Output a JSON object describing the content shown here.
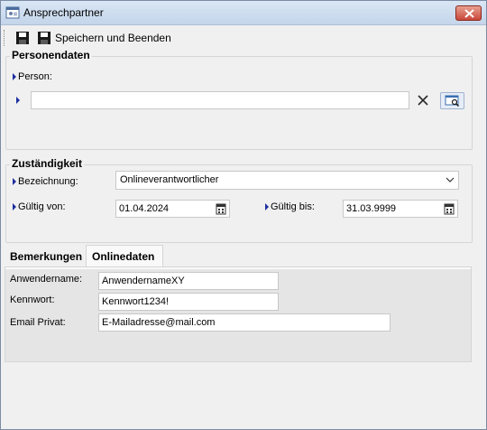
{
  "window": {
    "title": "Ansprechpartner"
  },
  "toolbar": {
    "save_close_label": "Speichern und Beenden"
  },
  "personendaten": {
    "group_title": "Personendaten",
    "person_label": "Person:",
    "person_value": ""
  },
  "zustaendigkeit": {
    "group_title": "Zuständigkeit",
    "bezeichnung_label": "Bezeichnung:",
    "bezeichnung_value": "Onlineverantwortlicher",
    "gueltig_von_label": "Gültig von:",
    "gueltig_von_value": "01.04.2024",
    "gueltig_bis_label": "Gültig bis:",
    "gueltig_bis_value": "31.03.9999"
  },
  "tabs": [
    {
      "label": "Bemerkungen",
      "active": false
    },
    {
      "label": "Onlinedaten",
      "active": true
    }
  ],
  "onlinedaten": {
    "anwendername_label": "Anwendername:",
    "anwendername_value": "AnwendernameXY",
    "kennwort_label": "Kennwort:",
    "kennwort_value": "Kennwort1234!",
    "email_label": "Email Privat:",
    "email_value": "E-Mailadresse@mail.com"
  },
  "icons": {
    "app": "contacts-window-icon",
    "save": "floppy-disk-icon",
    "save_close": "floppy-disk-icon",
    "clear": "close-x-icon",
    "lookup": "search-window-icon",
    "calendar": "calendar-icon"
  },
  "colors": {
    "field_marker": "#1d2f9e",
    "close_button": "#c9483a"
  }
}
